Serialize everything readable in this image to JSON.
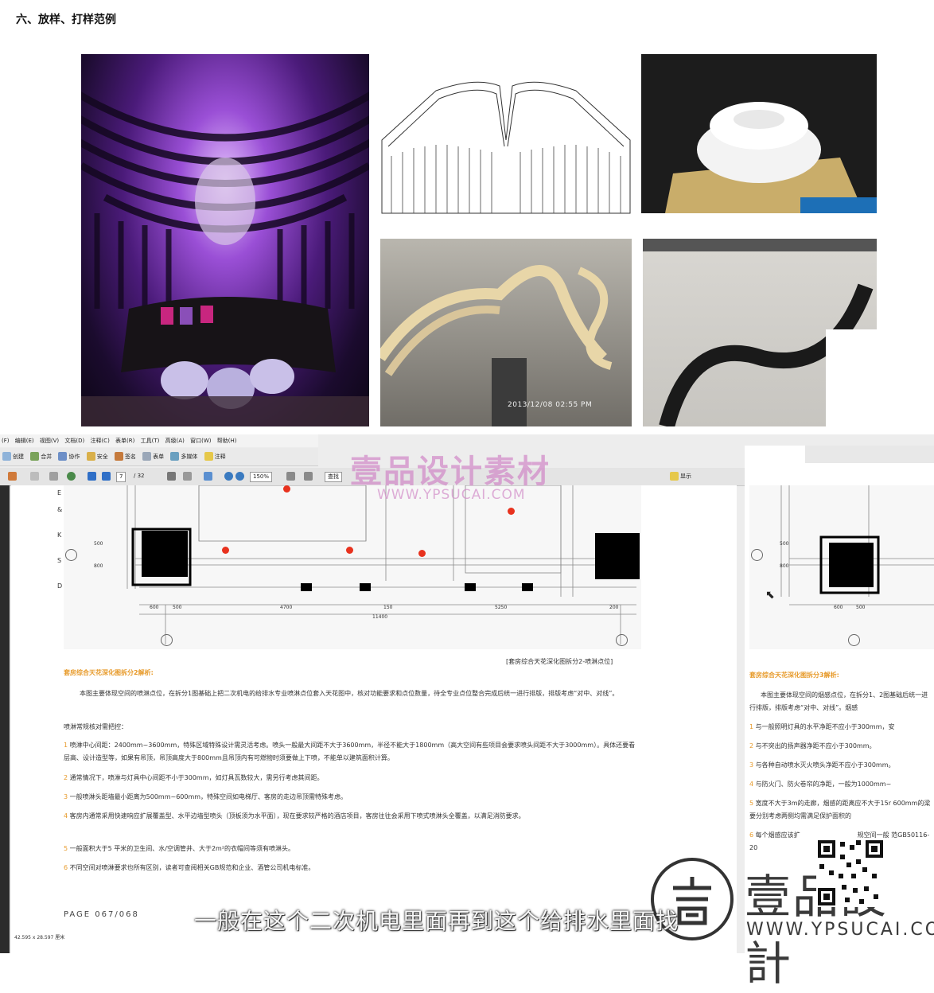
{
  "page": {
    "heading": "六、放样、打样范例"
  },
  "photos": {
    "timestamp": "2013/12/08  02:55 PM"
  },
  "app": {
    "menu": [
      "(F)",
      "编辑(E)",
      "视图(V)",
      "文档(D)",
      "注释(C)",
      "表单(R)",
      "工具(T)",
      "高级(A)",
      "窗口(W)",
      "帮助(H)"
    ],
    "toolbar1": [
      "创建",
      "合并",
      "协作",
      "安全",
      "签名",
      "表单",
      "多媒体",
      "注释"
    ],
    "toolbar2": {
      "page_current": "7",
      "page_total": "/ 32",
      "zoom": "150%",
      "find_placeholder": "查找",
      "right_label": "显示"
    },
    "status_size": "42.595 x 28.597 厘米"
  },
  "drawing": {
    "side_letters": [
      "E",
      "&",
      "K",
      "S",
      "D"
    ],
    "dims_vertical": [
      "500",
      "800"
    ],
    "dims_bottom": [
      "600",
      "500",
      "4700",
      "150",
      "5250",
      "200"
    ],
    "dim_total": "11400",
    "right_dims_vertical": [
      "500",
      "800"
    ],
    "right_dims_bottom": [
      "600",
      "500"
    ],
    "caption": "[套房综合天花深化图拆分2-喷淋点位]"
  },
  "doc": {
    "section_title": "套房综合天花深化图拆分2解析:",
    "intro": "本图主要体现空间的喷淋点位，在拆分1图基础上把二次机电的给排水专业喷淋点位套入天花图中，核对功能要求和点位数量，待全专业点位整合完成后统一进行排版，排版考虑“对中、对线”。",
    "rules_title": "喷淋常规核对需把控：",
    "items": [
      {
        "num": "1",
        "text": "喷淋中心间距：2400mm~3600mm，特殊区域特殊设计需灵活考虑。喷头一般最大间距不大于3600mm，半径不能大于1800mm（高大空间有些项目会要求喷头间距不大于3000mm）。具体还要看层高、设计造型等，如果有吊顶，吊顶高度大于800mm且吊顶内有可燃物时须要做上下喷，不能单以建筑面积计算。"
      },
      {
        "num": "2",
        "text": "通常情况下，喷淋与灯具中心间距不小于300mm，如灯具瓦数较大，需另行考虑其间距。"
      },
      {
        "num": "3",
        "text": "一般喷淋头距墙最小距离为500mm~600mm，特殊空间如电梯厅、客房的走边吊顶需特殊考虑。"
      },
      {
        "num": "4",
        "text": "客房内通常采用快速响应扩展覆盖型、水平边墙型喷头（顶板须为水平面），现在要求较严格的酒店项目，客房往往会采用下喷式喷淋头全覆盖，以满足消防要求。"
      },
      {
        "num": "5",
        "text": "一般面积大于5 平米的卫生间、水/空调管井、大于2m²的衣帽间等须有喷淋头。"
      },
      {
        "num": "6",
        "text": "不同空间对喷淋要求也所有区别，读者可查阅相关GB规范和企业、酒管公司机电标准。"
      }
    ],
    "page_number": "PAGE 067/068",
    "right_section_title": "套房综合天花深化图拆分3解析:",
    "right_intro": "本图主要体现空间的烟感点位，在拆分1、2图基础后统一进行排版，排版考虑“对中、对线”。烟感",
    "right_items": [
      {
        "num": "1",
        "text": "与一般照明灯具的水平净距不应小于300mm，安"
      },
      {
        "num": "2",
        "text": "与不突出的扬声器净距不应小于300mm。"
      },
      {
        "num": "3",
        "text": "与各种自动喷水灭火喷头净距不应小于300mm。"
      },
      {
        "num": "4",
        "text": "与防火门、防火卷帘的净距，一般为1000mm~"
      },
      {
        "num": "5",
        "text": "宽度不大于3m的走廊，烟感的距离应不大于15r 600mm的梁要分别考虑两侧均需满足保护面积的"
      },
      {
        "num": "6",
        "text": "每个烟感应该扩　　　　　　　　　规空间一般 范GB50116-20"
      }
    ]
  },
  "overlays": {
    "subtitle": "一般在这个二次机电里面再到这个给排水里面找",
    "watermark_cn": "壹品设计素材",
    "watermark_url": "WWW.YPSUCAI.COM",
    "brand_cn": "壹品設計",
    "brand_url": "WWW.YPSUCAI.COM"
  },
  "colors": {
    "accent_orange": "#e79a2a",
    "sprinkler_red": "#e8321e",
    "watermark_pink": "#d28cc8"
  }
}
